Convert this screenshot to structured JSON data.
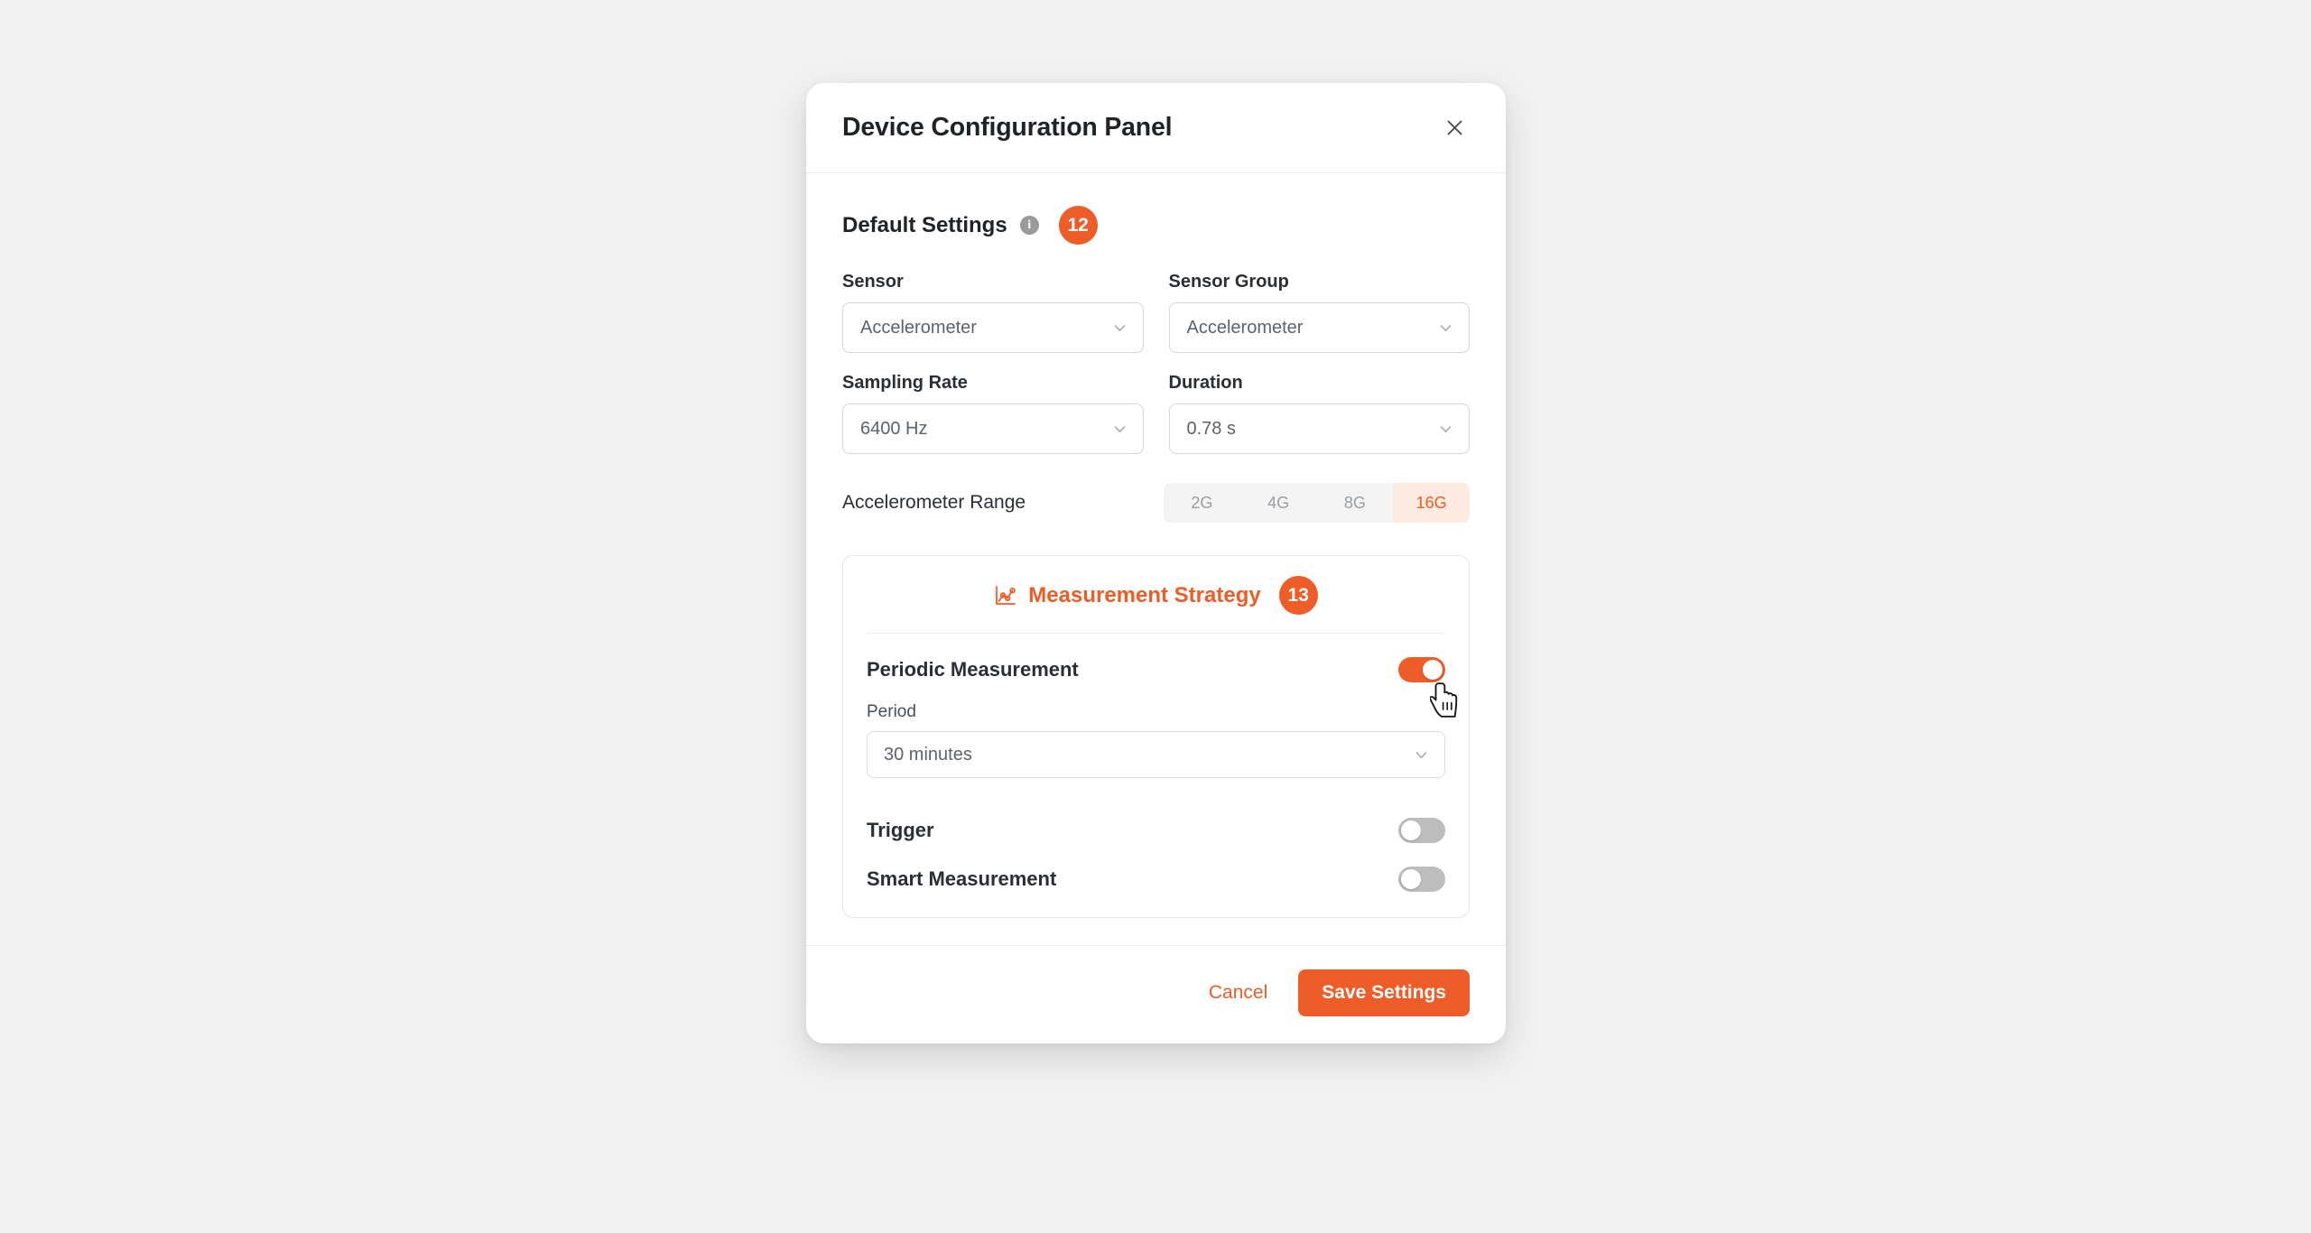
{
  "dialog": {
    "title": "Device Configuration Panel",
    "close_icon": "close-icon"
  },
  "section": {
    "title": "Default Settings",
    "info_icon": "i",
    "badge": "12"
  },
  "fields": [
    {
      "label": "Sensor",
      "value": "Accelerometer"
    },
    {
      "label": "Sensor Group",
      "value": "Accelerometer"
    },
    {
      "label": "Sampling Rate",
      "value": "6400 Hz"
    },
    {
      "label": "Duration",
      "value": "0.78 s"
    }
  ],
  "range": {
    "label": "Accelerometer Range",
    "options": [
      "2G",
      "4G",
      "8G",
      "16G"
    ],
    "selected": "16G"
  },
  "strategy": {
    "title": "Measurement Strategy",
    "badge": "13",
    "icon": "line-chart-icon",
    "periodic": {
      "label": "Periodic Measurement",
      "state": "on"
    },
    "period": {
      "label": "Period",
      "value": "30 minutes"
    },
    "trigger": {
      "label": "Trigger",
      "state": "off"
    },
    "smart": {
      "label": "Smart Measurement",
      "state": "off"
    }
  },
  "footer": {
    "cancel_label": "Cancel",
    "save_label": "Save Settings"
  },
  "colors": {
    "accent": "#ee5c28",
    "accent_soft": "#fdeae0",
    "page_bg": "#f2f2f2",
    "text": "#1f2326",
    "muted": "#9b9fa3"
  }
}
